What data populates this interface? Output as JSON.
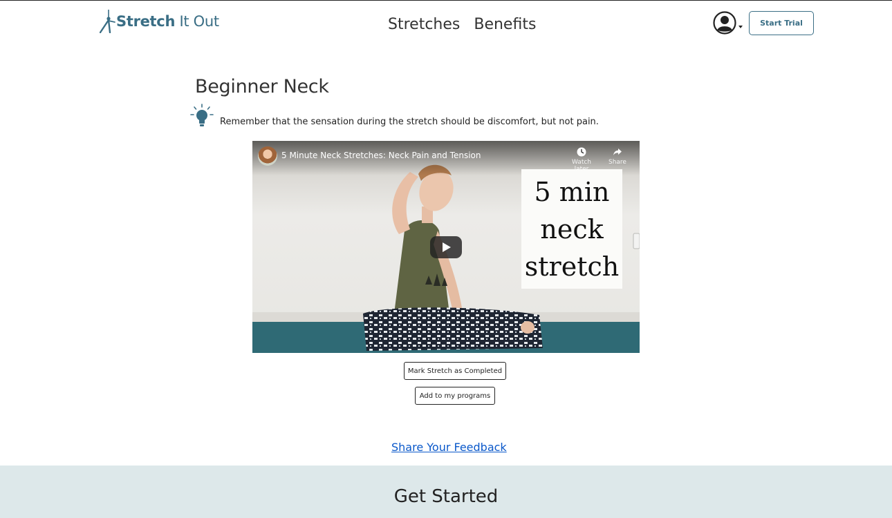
{
  "header": {
    "logo_bold": "Stretch",
    "logo_light": " It Out",
    "nav": [
      {
        "label": "Stretches"
      },
      {
        "label": "Benefits"
      }
    ],
    "start_trial_label": "Start Trial"
  },
  "main": {
    "title": "Beginner Neck",
    "tip": "Remember that the sensation during the stretch should be discomfort, but not pain.",
    "video": {
      "title": "5 Minute Neck Stretches: Neck Pain and Tension",
      "watch_later": "Watch later",
      "share": "Share",
      "overlay_lines": [
        "5 min",
        "neck",
        "stretch"
      ]
    },
    "mark_completed_label": "Mark Stretch as Completed",
    "add_programs_label": "Add to my programs",
    "feedback_label": "Share Your Feedback"
  },
  "footer": {
    "heading": "Get Started"
  },
  "colors": {
    "brand": "#3a6e85",
    "link": "#0a58ca",
    "footer_bg": "#dde8ea"
  }
}
